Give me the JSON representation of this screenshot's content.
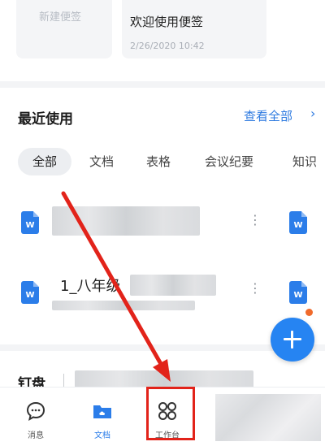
{
  "notes": {
    "new_note_label": "新建便签",
    "welcome_title": "欢迎使用便签",
    "welcome_date": "2/26/2020 10:42"
  },
  "recent": {
    "title": "最近使用",
    "view_all": "查看全部",
    "view_all_arrow": "›",
    "filters": [
      "全部",
      "文档",
      "表格",
      "会议纪要",
      "知识"
    ],
    "files": [
      {
        "icon": "W",
        "name": ""
      },
      {
        "icon": "W",
        "name": "1_八年级"
      }
    ],
    "more": "⋮"
  },
  "pan": {
    "title": "钉盘"
  },
  "tabbar": {
    "items": [
      {
        "label": "消息",
        "icon": "chat-bubble-icon"
      },
      {
        "label": "文档",
        "icon": "folder-cloud-icon"
      },
      {
        "label": "工作台",
        "icon": "workbench-grid-icon"
      }
    ]
  },
  "colors": {
    "accent": "#2b7de9",
    "fab": "#2684f2",
    "annotation_red": "#e2231a"
  }
}
